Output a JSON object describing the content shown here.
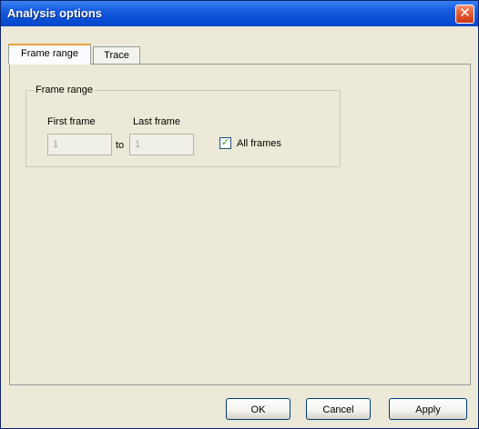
{
  "window": {
    "title": "Analysis options",
    "close_symbol": "✕"
  },
  "tabs": [
    {
      "label": "Frame range",
      "active": true
    },
    {
      "label": "Trace",
      "active": false
    }
  ],
  "frame_range": {
    "group_title": "Frame range",
    "first_frame_label": "First frame",
    "first_frame_value": "1",
    "last_frame_label": "Last frame",
    "last_frame_value": "1",
    "to_label": "to",
    "all_frames_label": "All frames",
    "all_frames_checked": true,
    "check_mark": "✓"
  },
  "buttons": {
    "ok": "OK",
    "cancel": "Cancel",
    "apply": "Apply"
  },
  "colors": {
    "titlebar": "#0a4fd6",
    "dialog_bg": "#ece9d8",
    "tab_highlight": "#e8a33d",
    "close_button": "#e2552d"
  }
}
